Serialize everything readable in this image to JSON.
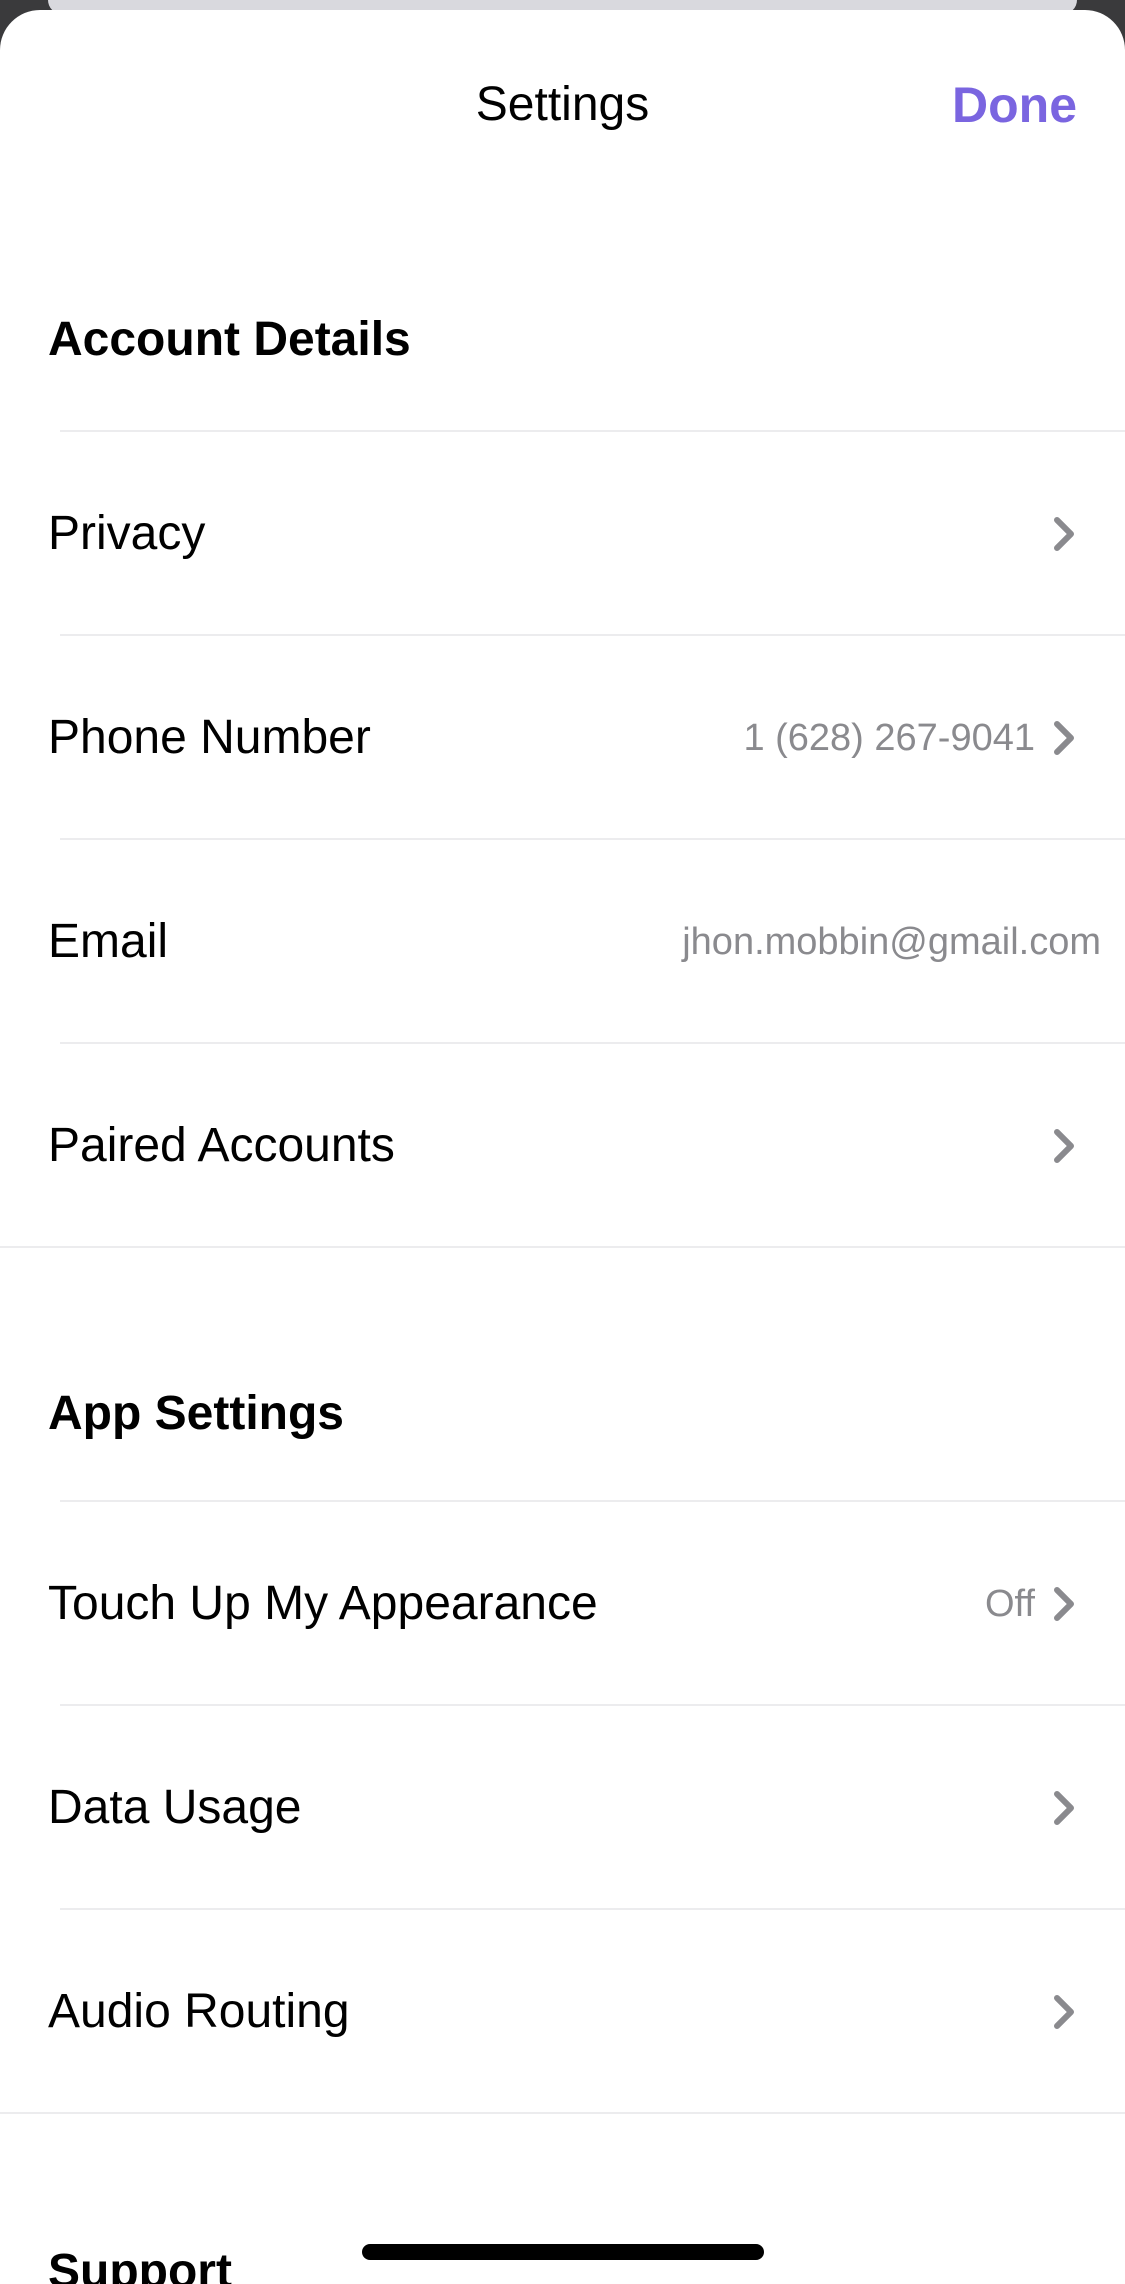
{
  "header": {
    "title": "Settings",
    "done_label": "Done"
  },
  "sections": {
    "account": {
      "title": "Account Details",
      "privacy_label": "Privacy",
      "phone_label": "Phone Number",
      "phone_value": "1 (628) 267-9041",
      "email_label": "Email",
      "email_value": "jhon.mobbin@gmail.com",
      "paired_label": "Paired Accounts"
    },
    "app": {
      "title": "App Settings",
      "touchup_label": "Touch Up My Appearance",
      "touchup_value": "Off",
      "data_label": "Data Usage",
      "audio_label": "Audio Routing"
    },
    "support": {
      "title": "Support"
    }
  },
  "colors": {
    "accent": "#7a65e0",
    "secondary_text": "#8a8a8e",
    "separator": "#ececee"
  },
  "icons": {
    "row_disclosure": "chevron-right-icon"
  }
}
